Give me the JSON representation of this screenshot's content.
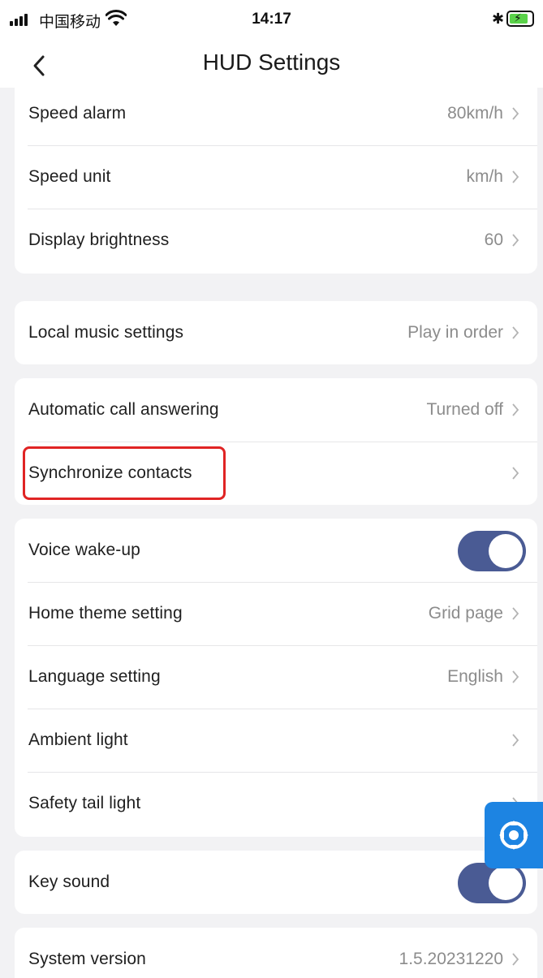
{
  "status_bar": {
    "carrier": "中国移动",
    "time": "14:17",
    "icons": [
      "signal-icon",
      "wifi-icon",
      "bluetooth-icon",
      "battery-charging-icon"
    ]
  },
  "nav": {
    "title": "HUD Settings",
    "back_icon": "chevron-left-icon"
  },
  "groups": [
    {
      "items": [
        {
          "label": "Speed alarm",
          "value": "80km/h"
        },
        {
          "label": "Speed unit",
          "value": "km/h"
        },
        {
          "label": "Display brightness",
          "value": "60"
        }
      ]
    },
    {
      "items": [
        {
          "label": "Local music settings",
          "value": "Play in order"
        }
      ]
    },
    {
      "items": [
        {
          "label": "Automatic call answering",
          "value": "Turned off"
        },
        {
          "label": "Synchronize contacts",
          "value": ""
        }
      ]
    },
    {
      "items": [
        {
          "label": "Voice wake-up",
          "toggle": true
        },
        {
          "label": "Home theme setting",
          "value": "Grid page"
        },
        {
          "label": "Language setting",
          "value": "English"
        },
        {
          "label": "Ambient light",
          "value": ""
        },
        {
          "label": "Safety tail light",
          "value": ""
        }
      ]
    },
    {
      "items": [
        {
          "label": "Key sound",
          "toggle": true
        }
      ]
    },
    {
      "items": [
        {
          "label": "System version",
          "value": "1.5.20231220"
        }
      ]
    }
  ],
  "colors": {
    "toggle_on": "#4a5b94",
    "highlight": "#e02424",
    "float_button": "#1d84e2"
  },
  "float_button": {
    "icon": "assistive-touch-icon"
  }
}
